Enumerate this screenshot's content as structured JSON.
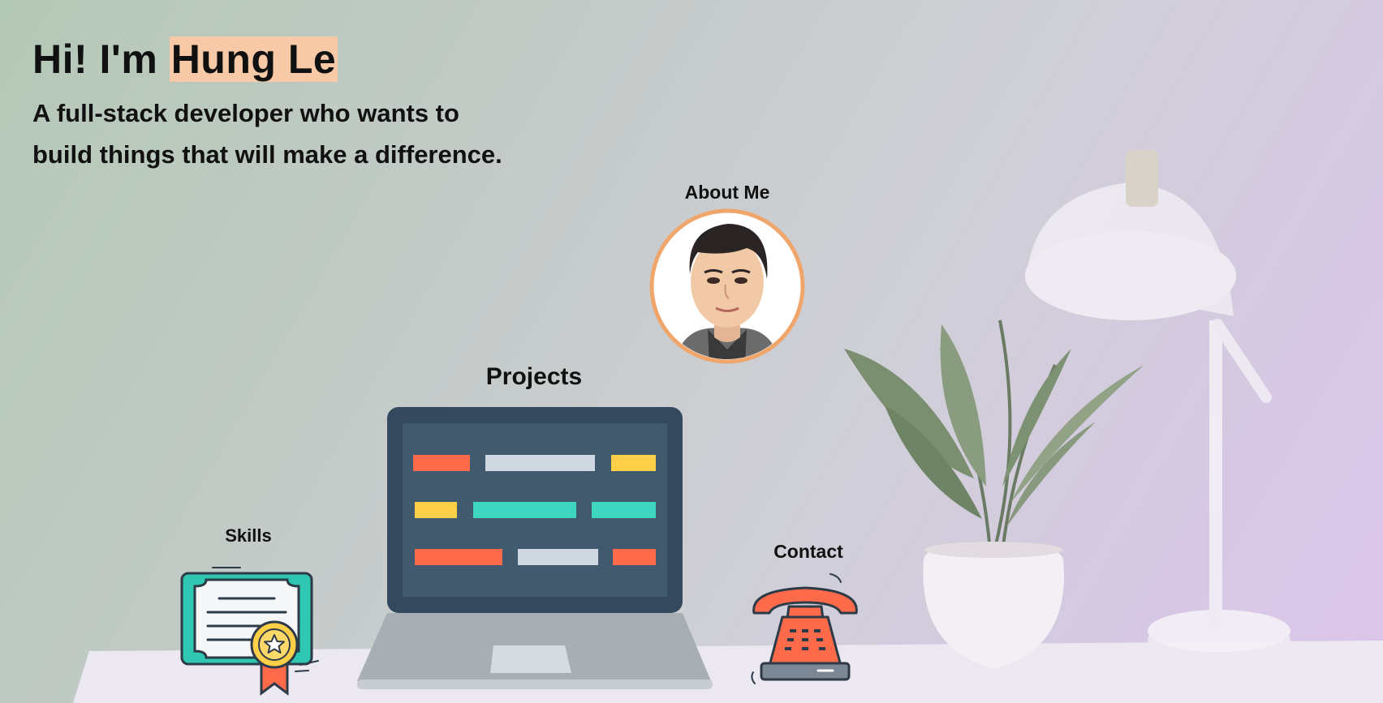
{
  "hero": {
    "greeting": "Hi! I'm ",
    "name": "Hung Le",
    "tagline_line1": "A full-stack developer who wants to",
    "tagline_line2": "build things that will make a difference."
  },
  "nav": {
    "about_label": "About Me",
    "projects_label": "Projects",
    "skills_label": "Skills",
    "contact_label": "Contact"
  },
  "icons": {
    "about": "avatar-portrait",
    "projects": "laptop-icon",
    "skills": "certificate-icon",
    "contact": "telephone-icon"
  },
  "colors": {
    "highlight": "#f8c9a7",
    "avatar_ring": "#f0a56a",
    "laptop_screen": "#34495e",
    "accent_red": "#ff6b4a",
    "accent_teal": "#3ed6c0",
    "accent_yellow": "#ffcf48"
  }
}
